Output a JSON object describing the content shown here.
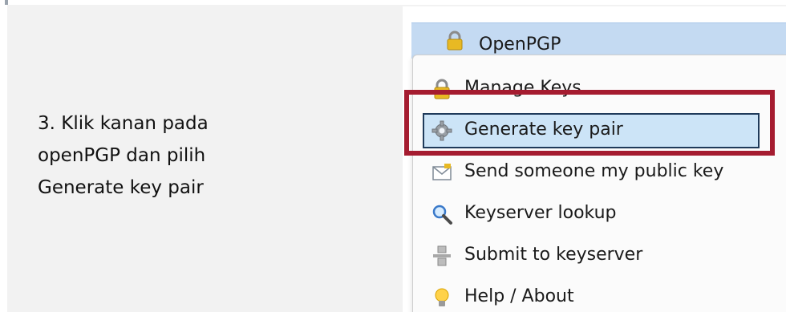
{
  "instruction": {
    "lines": [
      "3. Klik kanan pada",
      "openPGP dan pilih",
      "Generate key pair"
    ]
  },
  "tree": {
    "node_label": "OpenPGP",
    "node_icon": "padlock-icon"
  },
  "context_menu": {
    "items": [
      {
        "label": "Manage Keys",
        "icon": "padlock-icon"
      },
      {
        "label": "Generate key pair",
        "icon": "gear-icon"
      },
      {
        "label": "Send someone my public key",
        "icon": "envelope-icon"
      },
      {
        "label": "Keyserver lookup",
        "icon": "magnifier-icon"
      },
      {
        "label": "Submit to keyserver",
        "icon": "server-icon"
      },
      {
        "label": "Help / About",
        "icon": "lightbulb-icon"
      }
    ],
    "selected_item": "Generate key pair"
  },
  "colors": {
    "highlight_border": "#a51c30",
    "selection_bg": "#cce4f7",
    "tree_node_bg": "#c4daf2",
    "slide_bg": "#f2f2f2"
  }
}
